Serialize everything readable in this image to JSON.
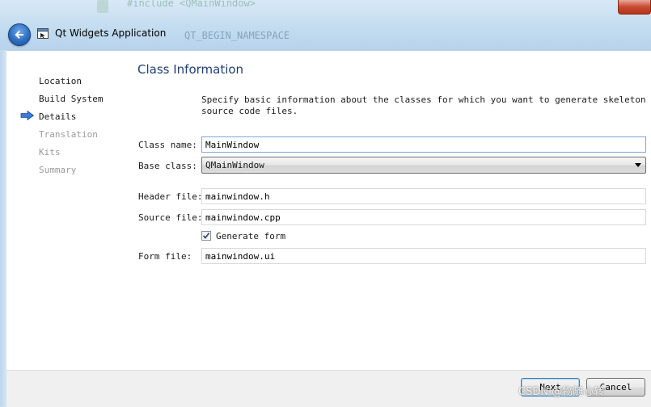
{
  "window": {
    "title": "Qt Widgets Application",
    "background_code": [
      "#include <QMainWindow>",
      "QT_BEGIN_NAMESPACE"
    ]
  },
  "sidebar": {
    "items": [
      {
        "label": "Location",
        "state": "done"
      },
      {
        "label": "Build System",
        "state": "done"
      },
      {
        "label": "Details",
        "state": "current"
      },
      {
        "label": "Translation",
        "state": "pending"
      },
      {
        "label": "Kits",
        "state": "pending"
      },
      {
        "label": "Summary",
        "state": "pending"
      }
    ]
  },
  "page": {
    "title": "Class Information",
    "description": "Specify basic information about the classes for which you want to generate skeleton source code files."
  },
  "form": {
    "class_name_label": "Class name:",
    "class_name_value": "MainWindow",
    "base_class_label": "Base class:",
    "base_class_value": "QMainWindow",
    "header_file_label": "Header file:",
    "header_file_value": "mainwindow.h",
    "source_file_label": "Source file:",
    "source_file_value": "mainwindow.cpp",
    "generate_form_label": "Generate form",
    "generate_form_checked": true,
    "form_file_label": "Form file:",
    "form_file_value": "mainwindow.ui"
  },
  "footer": {
    "next_label": "Next",
    "cancel_label": "Cancel"
  },
  "watermark": "CSDN @物随心转",
  "colors": {
    "title_blue": "#1f3e79",
    "pending_gray": "#9a9a9a",
    "arrow_blue": "#3d7ad8"
  }
}
